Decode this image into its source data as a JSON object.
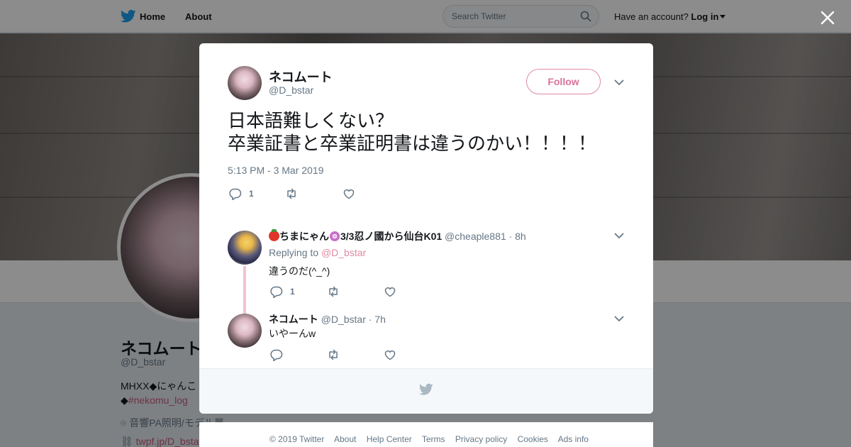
{
  "nav": {
    "home_label": "Home",
    "about_label": "About",
    "search_placeholder": "Search Twitter",
    "have_account": "Have an account?",
    "login_label": "Log in"
  },
  "profile": {
    "name": "ネコムート",
    "handle": "@D_bstar",
    "bio_line1": "MHXX◆にゃんこ",
    "bio_line2_prefix": "◆",
    "bio_hashtag": "#nekomu_log",
    "location": "音響PA照明/モデル業",
    "url": "twpf.jp/D_bsta"
  },
  "tweet": {
    "author_name": "ネコムート",
    "author_handle": "@D_bstar",
    "follow_label": "Follow",
    "text_line1": "日本語難しくない？",
    "text_line2": "卒業証書と卒業証明書は違うのかい！！！！",
    "timestamp": "5:13 PM - 3 Mar 2019",
    "reply_count": "1"
  },
  "replies": [
    {
      "name": "ちまにゃん",
      "name_suffix": "3/3忍ノ國から仙台K01",
      "handle": "@cheaple881",
      "age": "· 8h",
      "replying_to_label": "Replying to",
      "replying_to_handle": "@D_bstar",
      "text": "違うのだ(^_^)",
      "reply_count": "1"
    },
    {
      "name": "ネコムート",
      "handle": "@D_bstar",
      "age": "· 7h",
      "text": "いやーんw"
    }
  ],
  "footer": {
    "copyright": "© 2019 Twitter",
    "links": [
      "About",
      "Help Center",
      "Terms",
      "Privacy policy",
      "Cookies",
      "Ads info"
    ]
  },
  "colors": {
    "accent": "#e08aa3",
    "link": "#c45c7a",
    "muted": "#657786",
    "twitter_blue": "#1da1f2"
  }
}
